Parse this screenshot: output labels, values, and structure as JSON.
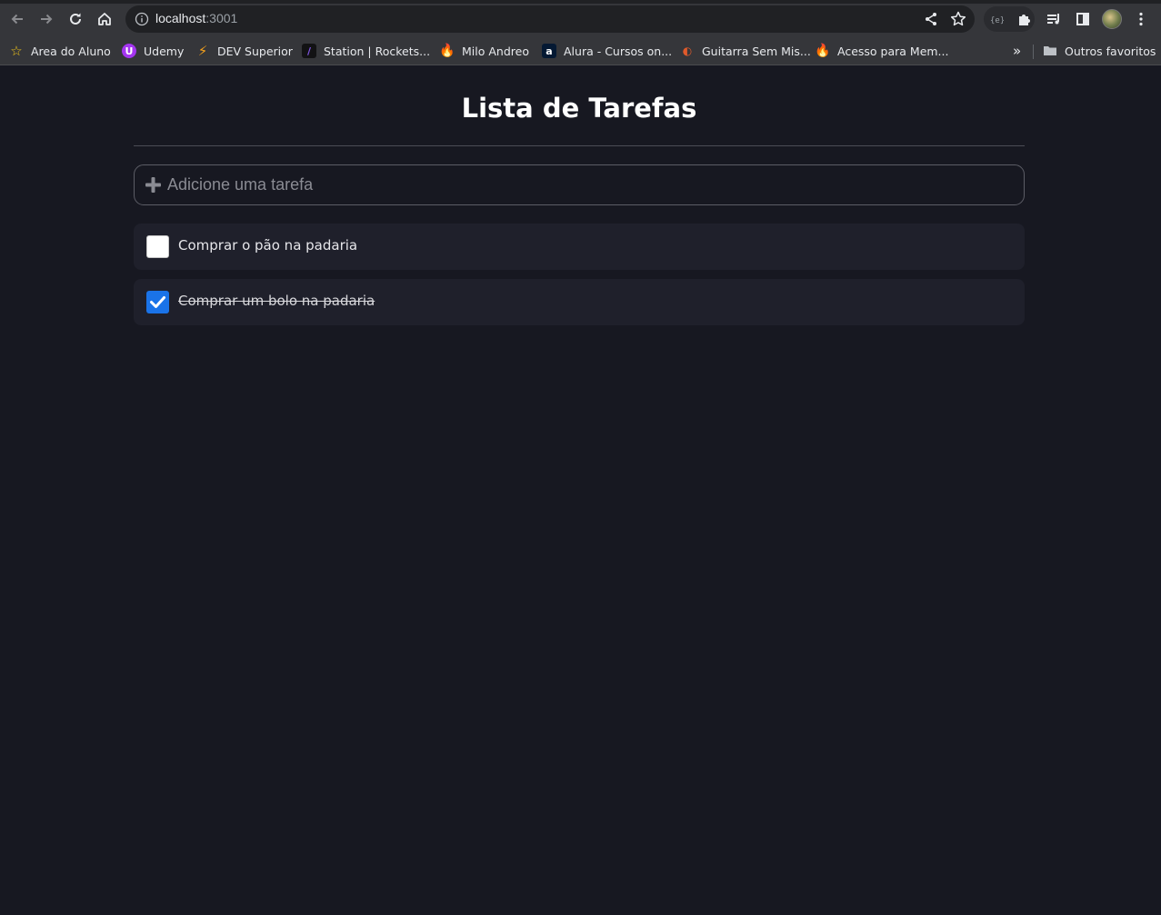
{
  "browser": {
    "url_host": "localhost",
    "url_port": ":3001",
    "bookmarks": [
      {
        "label": "Area do Aluno",
        "icon": "star-icon"
      },
      {
        "label": "Udemy",
        "icon": "udemy-icon"
      },
      {
        "label": "DEV Superior",
        "icon": "lightning-icon"
      },
      {
        "label": "Station | Rockets...",
        "icon": "rocketseat-icon"
      },
      {
        "label": "Milo Andreo",
        "icon": "flame-icon"
      },
      {
        "label": "Alura - Cursos on...",
        "icon": "alura-icon"
      },
      {
        "label": "Guitarra Sem Mis...",
        "icon": "guitar-icon"
      },
      {
        "label": "Acesso para Mem...",
        "icon": "flame-icon"
      }
    ],
    "other_bookmarks_label": "Outros favoritos",
    "more_label": "»"
  },
  "app": {
    "title": "Lista de Tarefas",
    "add_placeholder": "Adicione uma tarefa",
    "tasks": [
      {
        "text": "Comprar o pão na padaria",
        "done": false
      },
      {
        "text": "Comprar um bolo na padaria",
        "done": true
      }
    ]
  },
  "colors": {
    "background": "#171821",
    "task_card": "#1f202b",
    "checkbox_checked": "#1a73e8"
  }
}
